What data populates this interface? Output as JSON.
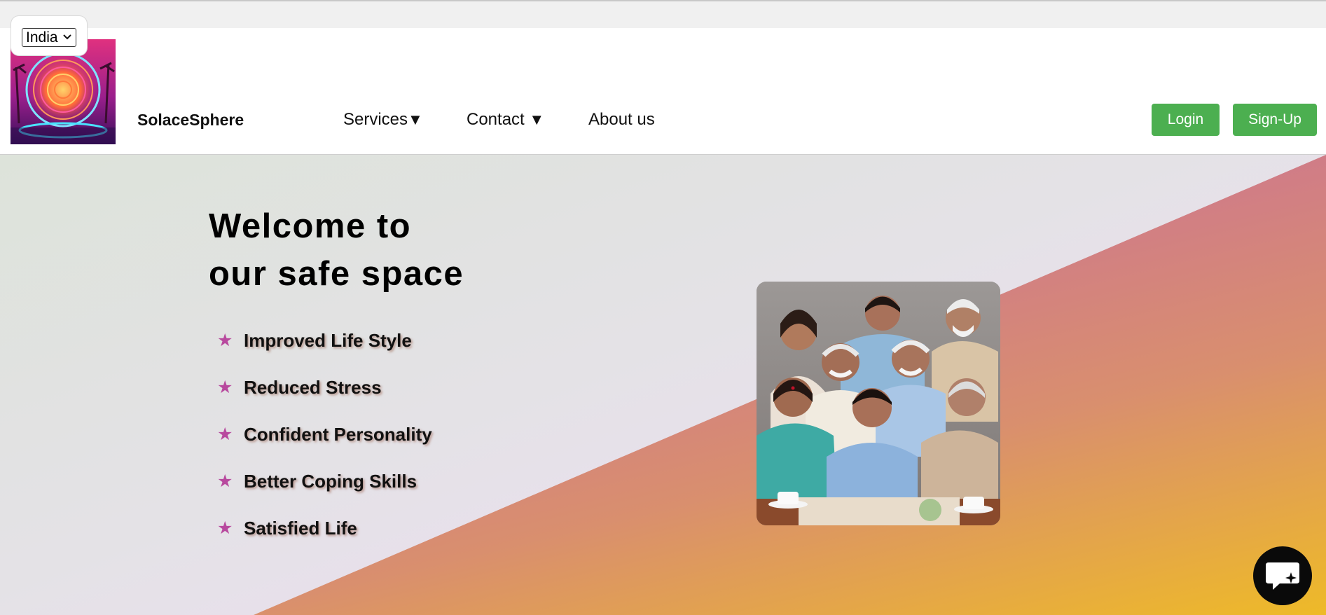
{
  "country_selector": {
    "selected": "India",
    "icon": "chevron-down-icon"
  },
  "header": {
    "brand_name": "SolaceSphere",
    "nav": {
      "services": "Services",
      "contact": "Contact",
      "about": "About us",
      "caret": "▼"
    },
    "login_label": "Login",
    "signup_label": "Sign-Up"
  },
  "hero": {
    "title_line1": "Welcome to",
    "title_line2": "our safe space",
    "bullet_icon": "star-icon",
    "benefits": [
      "Improved Life Style",
      "Reduced Stress",
      "Confident Personality",
      "Better Coping Skills",
      "Satisfied Life"
    ]
  },
  "chat_widget": {
    "icon": "chat-sparkle-icon"
  },
  "colors": {
    "button_green": "#4caf50",
    "star_pink": "#b8499e",
    "diagonal_top": "#cf7a8a",
    "diagonal_bottom": "#eeba28",
    "chat_button": "#0a0a0a"
  }
}
